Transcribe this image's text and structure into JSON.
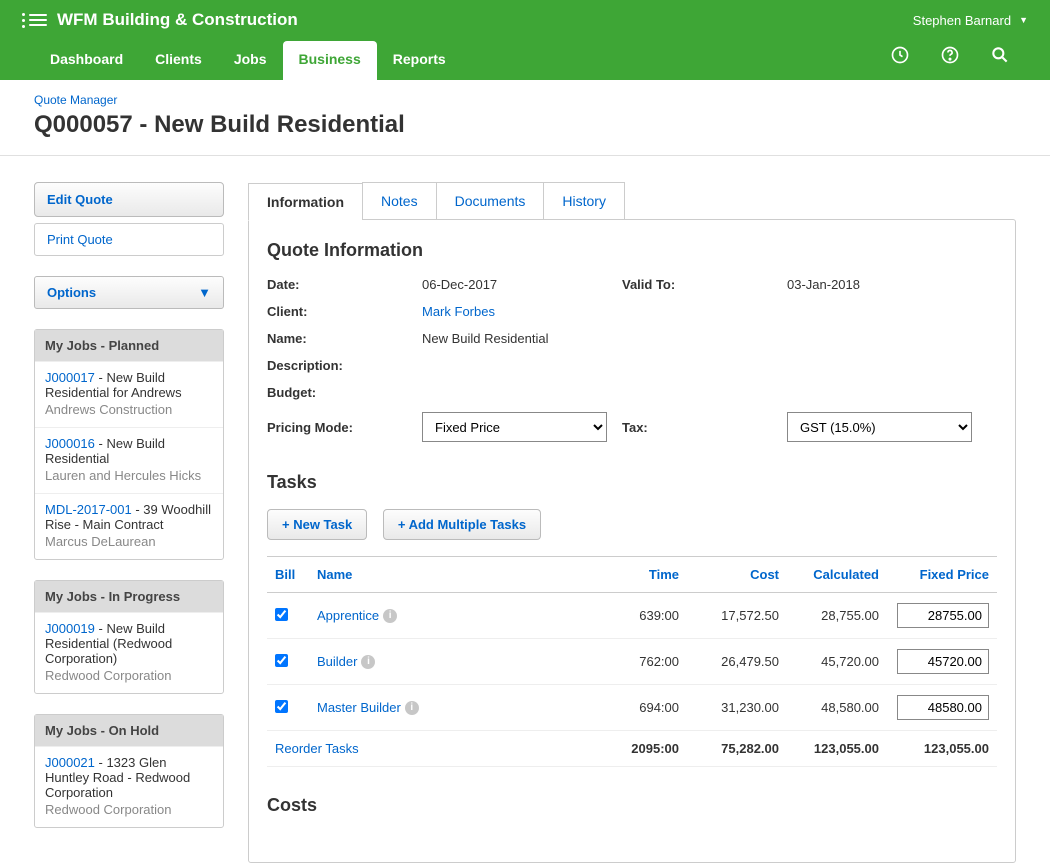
{
  "header": {
    "app_name": "WFM Building & Construction",
    "user_name": "Stephen Barnard"
  },
  "nav": {
    "items": [
      "Dashboard",
      "Clients",
      "Jobs",
      "Business",
      "Reports"
    ],
    "active": "Business"
  },
  "breadcrumb": {
    "parent": "Quote Manager"
  },
  "page": {
    "title": "Q000057 - New Build Residential"
  },
  "sidebar": {
    "edit_quote": "Edit Quote",
    "print_quote": "Print Quote",
    "options": "Options",
    "panels": [
      {
        "title": "My Jobs - Planned",
        "jobs": [
          {
            "num": "J000017",
            "name": "New Build Residential for Andrews",
            "client": "Andrews Construction"
          },
          {
            "num": "J000016",
            "name": "New Build Residential",
            "client": "Lauren and Hercules Hicks"
          },
          {
            "num": "MDL-2017-001",
            "name": "39 Woodhill Rise - Main Contract",
            "client": "Marcus DeLaurean"
          }
        ]
      },
      {
        "title": "My Jobs - In Progress",
        "jobs": [
          {
            "num": "J000019",
            "name": "New Build Residential (Redwood Corporation)",
            "client": "Redwood Corporation"
          }
        ]
      },
      {
        "title": "My Jobs - On Hold",
        "jobs": [
          {
            "num": "J000021",
            "name": "1323 Glen Huntley Road - Redwood Corporation",
            "client": "Redwood Corporation"
          }
        ]
      }
    ]
  },
  "tabs": {
    "items": [
      "Information",
      "Notes",
      "Documents",
      "History"
    ],
    "active": "Information"
  },
  "quote_info": {
    "section_title": "Quote Information",
    "labels": {
      "date": "Date:",
      "valid_to": "Valid To:",
      "client": "Client:",
      "name": "Name:",
      "description": "Description:",
      "budget": "Budget:",
      "pricing_mode": "Pricing Mode:",
      "tax": "Tax:"
    },
    "date": "06-Dec-2017",
    "valid_to": "03-Jan-2018",
    "client": "Mark Forbes",
    "name": "New Build Residential",
    "pricing_mode": "Fixed Price",
    "tax": "GST (15.0%)"
  },
  "tasks_section": {
    "title": "Tasks",
    "new_task_btn": "+ New Task",
    "add_multiple_btn": "+ Add Multiple Tasks",
    "columns": {
      "bill": "Bill",
      "name": "Name",
      "time": "Time",
      "cost": "Cost",
      "calculated": "Calculated",
      "fixed": "Fixed Price"
    },
    "rows": [
      {
        "bill": true,
        "name": "Apprentice",
        "time": "639:00",
        "cost": "17,572.50",
        "calculated": "28,755.00",
        "fixed": "28755.00"
      },
      {
        "bill": true,
        "name": "Builder",
        "time": "762:00",
        "cost": "26,479.50",
        "calculated": "45,720.00",
        "fixed": "45720.00"
      },
      {
        "bill": true,
        "name": "Master Builder",
        "time": "694:00",
        "cost": "31,230.00",
        "calculated": "48,580.00",
        "fixed": "48580.00"
      }
    ],
    "reorder": "Reorder Tasks",
    "totals": {
      "time": "2095:00",
      "cost": "75,282.00",
      "calculated": "123,055.00",
      "fixed": "123,055.00"
    }
  },
  "costs_section": {
    "title": "Costs"
  }
}
